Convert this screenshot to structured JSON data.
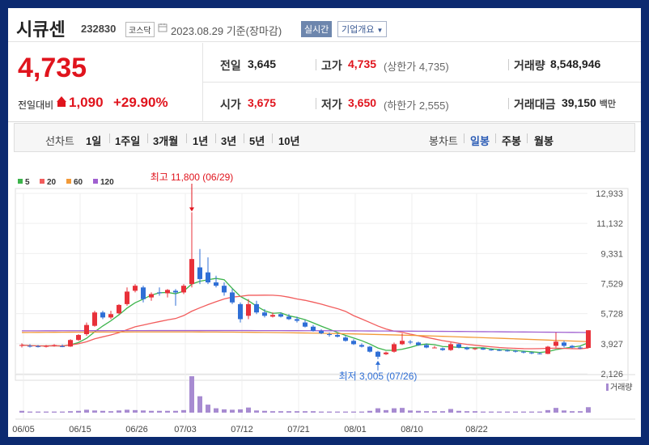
{
  "stock": {
    "name": "시큐센",
    "code": "232830",
    "market": "코스닥",
    "date": "2023.08.29",
    "basis": "기준(장마감)",
    "realtime": "실시간",
    "company_info": "기업개요"
  },
  "quote": {
    "price": "4,735",
    "change_label": "전일대비",
    "change_value": "1,090",
    "change_rate": "+29.90%",
    "prev_close_label": "전일",
    "prev_close": "3,645",
    "high_label": "고가",
    "high": "4,735",
    "upper_limit": "(상한가 4,735)",
    "volume_label": "거래량",
    "volume": "8,548,946",
    "open_label": "시가",
    "open": "3,675",
    "low_label": "저가",
    "low": "3,650",
    "lower_limit": "(하한가 2,555)",
    "amount_label": "거래대금",
    "amount": "39,150",
    "amount_unit": "백만"
  },
  "periods": {
    "line_chart": "선차트",
    "line_items": [
      "1일",
      "1주일",
      "3개월",
      "1년",
      "3년",
      "5년",
      "10년"
    ],
    "candle_chart": "봉차트",
    "candle_items": [
      "일봉",
      "주봉",
      "월봉"
    ],
    "selected_candle": "일봉"
  },
  "chart_data": {
    "type": "candlestick",
    "legend": [
      {
        "name": "5",
        "color": "#3cb44b"
      },
      {
        "name": "20",
        "color": "#f25c5c"
      },
      {
        "name": "60",
        "color": "#f29a38"
      },
      {
        "name": "120",
        "color": "#a060d0"
      }
    ],
    "y_ticks": [
      "12,933",
      "11,132",
      "9,331",
      "7,529",
      "5,728",
      "3,927",
      "2,126"
    ],
    "ylim": [
      2126,
      12933
    ],
    "x_ticks": [
      "06/05",
      "06/15",
      "06/26",
      "07/03",
      "07/12",
      "07/21",
      "08/01",
      "08/10",
      "08/22"
    ],
    "max_annotation": "최고 11,800 (06/29)",
    "min_annotation": "최저 3,005 (07/26)",
    "volume_label": "거래량",
    "up_color": "#e8313a",
    "down_color": "#2f6fd6",
    "volume_color": "#a78bd1",
    "candles": [
      {
        "o": 3800,
        "h": 3950,
        "l": 3700,
        "c": 3850
      },
      {
        "o": 3800,
        "h": 3900,
        "l": 3700,
        "c": 3780
      },
      {
        "o": 3780,
        "h": 3850,
        "l": 3700,
        "c": 3760
      },
      {
        "o": 3760,
        "h": 3850,
        "l": 3700,
        "c": 3790
      },
      {
        "o": 3800,
        "h": 3900,
        "l": 3750,
        "c": 3850
      },
      {
        "o": 3780,
        "h": 3880,
        "l": 3720,
        "c": 3760
      },
      {
        "o": 3760,
        "h": 4200,
        "l": 3740,
        "c": 4150
      },
      {
        "o": 4150,
        "h": 4500,
        "l": 4100,
        "c": 4450
      },
      {
        "o": 4500,
        "h": 5200,
        "l": 4400,
        "c": 5050
      },
      {
        "o": 5000,
        "h": 5900,
        "l": 4950,
        "c": 5800
      },
      {
        "o": 5800,
        "h": 5900,
        "l": 5400,
        "c": 5500
      },
      {
        "o": 5500,
        "h": 5900,
        "l": 5400,
        "c": 5700
      },
      {
        "o": 5750,
        "h": 6300,
        "l": 5700,
        "c": 6250
      },
      {
        "o": 6300,
        "h": 7300,
        "l": 6200,
        "c": 7050
      },
      {
        "o": 7100,
        "h": 7500,
        "l": 7000,
        "c": 7400
      },
      {
        "o": 7300,
        "h": 7400,
        "l": 6400,
        "c": 6600
      },
      {
        "o": 6700,
        "h": 7000,
        "l": 6500,
        "c": 6900
      },
      {
        "o": 7000,
        "h": 7300,
        "l": 6800,
        "c": 6950
      },
      {
        "o": 6950,
        "h": 7200,
        "l": 6700,
        "c": 7150
      },
      {
        "o": 7100,
        "h": 7200,
        "l": 6200,
        "c": 7000
      },
      {
        "o": 7000,
        "h": 7500,
        "l": 6900,
        "c": 7400
      },
      {
        "o": 7500,
        "h": 11800,
        "l": 7300,
        "c": 9000
      },
      {
        "o": 8500,
        "h": 9600,
        "l": 7500,
        "c": 7800
      },
      {
        "o": 8200,
        "h": 9100,
        "l": 7500,
        "c": 7600
      },
      {
        "o": 7600,
        "h": 8000,
        "l": 7300,
        "c": 7400
      },
      {
        "o": 7400,
        "h": 7600,
        "l": 6800,
        "c": 7000
      },
      {
        "o": 7000,
        "h": 7200,
        "l": 6300,
        "c": 6400
      },
      {
        "o": 6300,
        "h": 6400,
        "l": 5200,
        "c": 5400
      },
      {
        "o": 5600,
        "h": 6600,
        "l": 5400,
        "c": 6300
      },
      {
        "o": 6300,
        "h": 6500,
        "l": 5700,
        "c": 5800
      },
      {
        "o": 5800,
        "h": 6000,
        "l": 5500,
        "c": 5600
      },
      {
        "o": 5550,
        "h": 5800,
        "l": 5500,
        "c": 5650
      },
      {
        "o": 5700,
        "h": 5800,
        "l": 5500,
        "c": 5550
      },
      {
        "o": 5550,
        "h": 5700,
        "l": 5350,
        "c": 5400
      },
      {
        "o": 5400,
        "h": 5550,
        "l": 5200,
        "c": 5300
      },
      {
        "o": 5200,
        "h": 5350,
        "l": 4900,
        "c": 4950
      },
      {
        "o": 4950,
        "h": 5050,
        "l": 4650,
        "c": 4700
      },
      {
        "o": 4700,
        "h": 4800,
        "l": 4500,
        "c": 4550
      },
      {
        "o": 4500,
        "h": 4600,
        "l": 4350,
        "c": 4450
      },
      {
        "o": 4450,
        "h": 4550,
        "l": 4300,
        "c": 4350
      },
      {
        "o": 4300,
        "h": 4400,
        "l": 4050,
        "c": 4100
      },
      {
        "o": 4100,
        "h": 4200,
        "l": 3850,
        "c": 3900
      },
      {
        "o": 3850,
        "h": 3950,
        "l": 3700,
        "c": 3750
      },
      {
        "o": 3750,
        "h": 3800,
        "l": 3400,
        "c": 3450
      },
      {
        "o": 3450,
        "h": 3500,
        "l": 3005,
        "c": 3150
      },
      {
        "o": 3300,
        "h": 3450,
        "l": 3250,
        "c": 3400
      },
      {
        "o": 3450,
        "h": 4000,
        "l": 3400,
        "c": 3900
      },
      {
        "o": 3900,
        "h": 4550,
        "l": 3850,
        "c": 4100
      },
      {
        "o": 4050,
        "h": 4150,
        "l": 3900,
        "c": 4000
      },
      {
        "o": 4000,
        "h": 4050,
        "l": 3800,
        "c": 3850
      },
      {
        "o": 3850,
        "h": 3950,
        "l": 3650,
        "c": 3700
      },
      {
        "o": 3700,
        "h": 3800,
        "l": 3650,
        "c": 3700
      },
      {
        "o": 3650,
        "h": 3700,
        "l": 3500,
        "c": 3550
      },
      {
        "o": 3550,
        "h": 4000,
        "l": 3500,
        "c": 3900
      },
      {
        "o": 3900,
        "h": 3950,
        "l": 3650,
        "c": 3700
      },
      {
        "o": 3700,
        "h": 3750,
        "l": 3550,
        "c": 3600
      },
      {
        "o": 3600,
        "h": 3700,
        "l": 3550,
        "c": 3650
      },
      {
        "o": 3650,
        "h": 3700,
        "l": 3550,
        "c": 3580
      },
      {
        "o": 3580,
        "h": 3650,
        "l": 3500,
        "c": 3550
      },
      {
        "o": 3550,
        "h": 3620,
        "l": 3480,
        "c": 3520
      },
      {
        "o": 3520,
        "h": 3600,
        "l": 3450,
        "c": 3500
      },
      {
        "o": 3500,
        "h": 3550,
        "l": 3400,
        "c": 3450
      },
      {
        "o": 3450,
        "h": 3500,
        "l": 3350,
        "c": 3400
      },
      {
        "o": 3400,
        "h": 3450,
        "l": 3300,
        "c": 3350
      },
      {
        "o": 3350,
        "h": 3420,
        "l": 3280,
        "c": 3320
      },
      {
        "o": 3320,
        "h": 3800,
        "l": 3300,
        "c": 3750
      },
      {
        "o": 3800,
        "h": 4600,
        "l": 3700,
        "c": 4050
      },
      {
        "o": 4000,
        "h": 4100,
        "l": 3700,
        "c": 3800
      },
      {
        "o": 3800,
        "h": 3850,
        "l": 3650,
        "c": 3700
      },
      {
        "o": 3700,
        "h": 3800,
        "l": 3600,
        "c": 3650
      },
      {
        "o": 3675,
        "h": 4735,
        "l": 3650,
        "c": 4735
      }
    ],
    "volumes": [
      0.5,
      0.3,
      0.3,
      0.3,
      0.3,
      0.3,
      0.4,
      0.5,
      0.8,
      0.6,
      0.5,
      0.4,
      0.6,
      0.8,
      0.7,
      0.6,
      0.5,
      0.5,
      0.5,
      0.5,
      0.7,
      10,
      4.5,
      2.2,
      1.2,
      0.9,
      0.8,
      0.9,
      1.4,
      0.6,
      0.5,
      0.4,
      0.4,
      0.4,
      0.4,
      0.4,
      0.4,
      0.3,
      0.3,
      0.3,
      0.3,
      0.3,
      0.3,
      0.5,
      1.2,
      0.7,
      1.2,
      1.3,
      0.6,
      0.5,
      0.4,
      0.4,
      0.4,
      1.0,
      0.5,
      0.4,
      0.4,
      0.3,
      0.3,
      0.3,
      0.3,
      0.3,
      0.3,
      0.3,
      0.3,
      0.7,
      1.3,
      0.6,
      0.4,
      0.4,
      1.5
    ]
  }
}
